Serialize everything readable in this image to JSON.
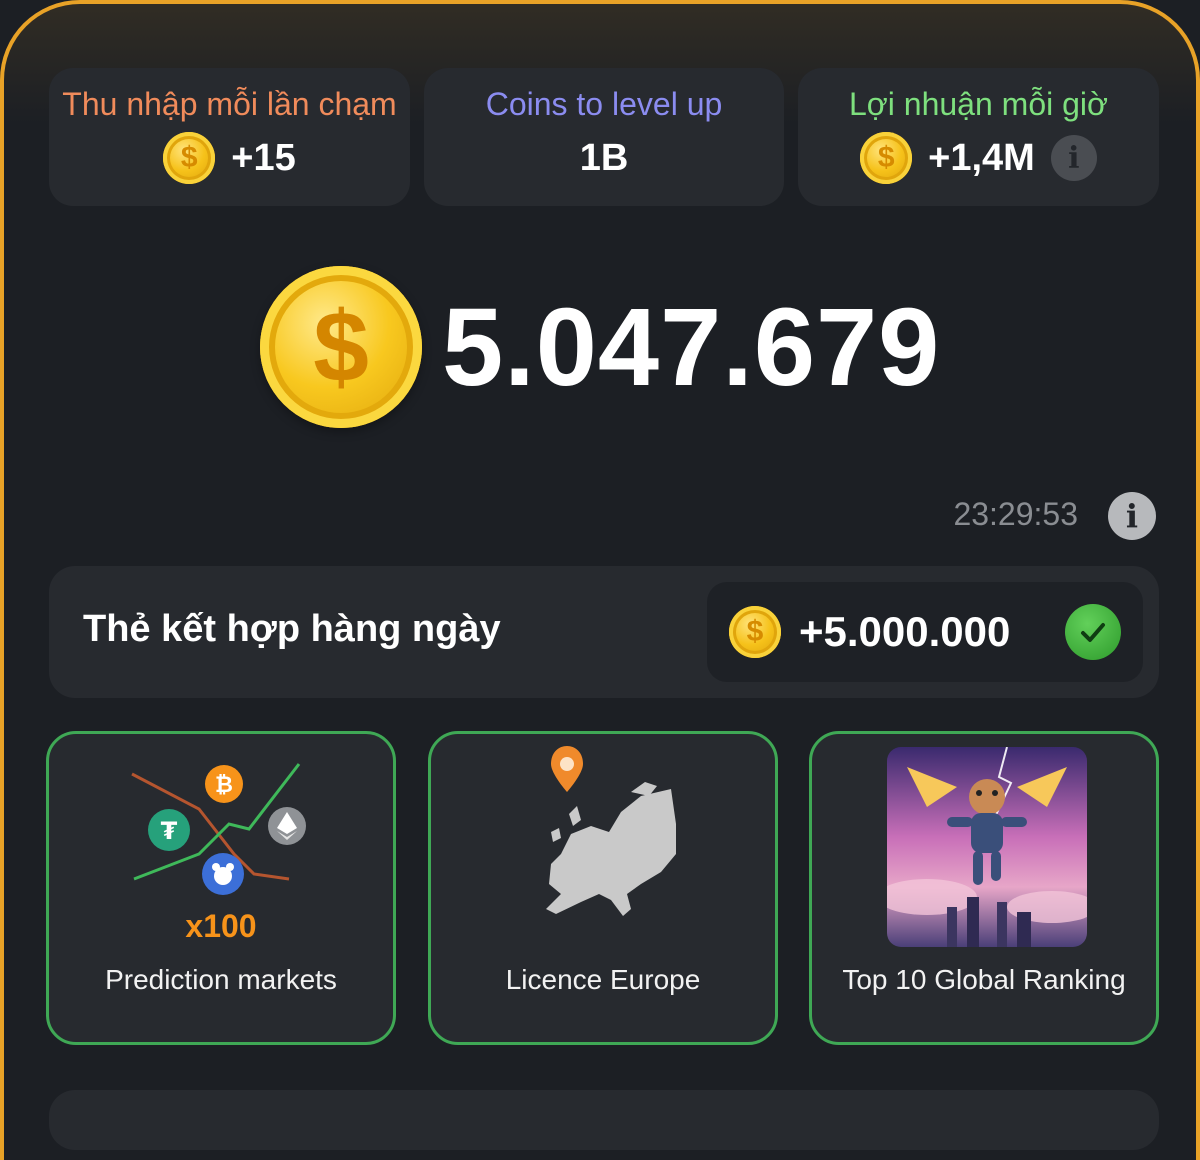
{
  "stats": [
    {
      "label": "Thu nhập mỗi lần chạm",
      "value": "+15",
      "label_color": "#f08b5b"
    },
    {
      "label": "Coins to level up",
      "value": "1B",
      "label_color": "#8b8cf0"
    },
    {
      "label": "Lợi nhuận mỗi giờ",
      "value": "+1,4M",
      "label_color": "#7ee07e"
    }
  ],
  "balance": "5.047.679",
  "timer": "23:29:53",
  "combo": {
    "title": "Thẻ kết hợp hàng ngày",
    "amount": "+5.000.000"
  },
  "cards": [
    {
      "label": "Prediction markets",
      "badge": "x100"
    },
    {
      "label": "Licence Europe"
    },
    {
      "label": "Top 10 Global Ranking"
    }
  ],
  "colors": {
    "accent": "#e8a227",
    "card_border": "#3fa855",
    "coin": "#f6c21a",
    "background": "#1c1f24"
  },
  "icons": {
    "coin": "coin-icon",
    "info": "info-icon",
    "check": "check-icon"
  }
}
